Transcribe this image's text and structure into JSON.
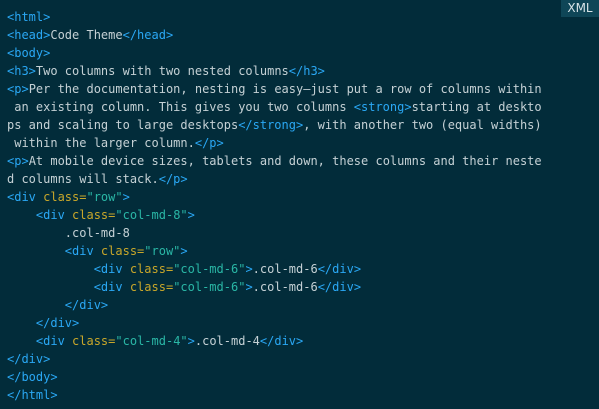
{
  "badge": {
    "language": "XML"
  },
  "colors": {
    "background": "#022c3a",
    "tag": "#2aa8f5",
    "attribute": "#c9a72a",
    "string": "#2ab7a6",
    "text": "#c5d1d5",
    "badge_background": "#0f4657"
  },
  "code": {
    "lines": [
      [
        {
          "t": "tag",
          "v": "<html>"
        }
      ],
      [
        {
          "t": "tag",
          "v": "<head>"
        },
        {
          "t": "txt",
          "v": "Code Theme"
        },
        {
          "t": "tag",
          "v": "</head>"
        }
      ],
      [
        {
          "t": "tag",
          "v": "<body>"
        }
      ],
      [
        {
          "t": "tag",
          "v": "<h3>"
        },
        {
          "t": "txt",
          "v": "Two columns with two nested columns"
        },
        {
          "t": "tag",
          "v": "</h3>"
        }
      ],
      [
        {
          "t": "tag",
          "v": "<p>"
        },
        {
          "t": "txt",
          "v": "Per the documentation, nesting is easy—just put a row of columns within"
        }
      ],
      [
        {
          "t": "txt",
          "v": " an existing column. This gives you two columns "
        },
        {
          "t": "tag",
          "v": "<strong>"
        },
        {
          "t": "txt",
          "v": "starting at deskto"
        }
      ],
      [
        {
          "t": "txt",
          "v": "ps and scaling to large desktops"
        },
        {
          "t": "tag",
          "v": "</strong>"
        },
        {
          "t": "txt",
          "v": ", with another two (equal widths)"
        }
      ],
      [
        {
          "t": "txt",
          "v": " within the larger column."
        },
        {
          "t": "tag",
          "v": "</p>"
        }
      ],
      [
        {
          "t": "tag",
          "v": "<p>"
        },
        {
          "t": "txt",
          "v": "At mobile device sizes, tablets and down, these columns and their neste"
        }
      ],
      [
        {
          "t": "txt",
          "v": "d columns will stack."
        },
        {
          "t": "tag",
          "v": "</p>"
        }
      ],
      [
        {
          "t": "tag",
          "v": "<div "
        },
        {
          "t": "attr",
          "v": "class="
        },
        {
          "t": "str",
          "v": "\"row\""
        },
        {
          "t": "tag",
          "v": ">"
        }
      ],
      [
        {
          "t": "txt",
          "v": "    "
        },
        {
          "t": "tag",
          "v": "<div "
        },
        {
          "t": "attr",
          "v": "class="
        },
        {
          "t": "str",
          "v": "\"col-md-8\""
        },
        {
          "t": "tag",
          "v": ">"
        }
      ],
      [
        {
          "t": "txt",
          "v": "        .col-md-8"
        }
      ],
      [
        {
          "t": "txt",
          "v": "        "
        },
        {
          "t": "tag",
          "v": "<div "
        },
        {
          "t": "attr",
          "v": "class="
        },
        {
          "t": "str",
          "v": "\"row\""
        },
        {
          "t": "tag",
          "v": ">"
        }
      ],
      [
        {
          "t": "txt",
          "v": "            "
        },
        {
          "t": "tag",
          "v": "<div "
        },
        {
          "t": "attr",
          "v": "class="
        },
        {
          "t": "str",
          "v": "\"col-md-6\""
        },
        {
          "t": "tag",
          "v": ">"
        },
        {
          "t": "txt",
          "v": ".col-md-6"
        },
        {
          "t": "tag",
          "v": "</div>"
        }
      ],
      [
        {
          "t": "txt",
          "v": "            "
        },
        {
          "t": "tag",
          "v": "<div "
        },
        {
          "t": "attr",
          "v": "class="
        },
        {
          "t": "str",
          "v": "\"col-md-6\""
        },
        {
          "t": "tag",
          "v": ">"
        },
        {
          "t": "txt",
          "v": ".col-md-6"
        },
        {
          "t": "tag",
          "v": "</div>"
        }
      ],
      [
        {
          "t": "txt",
          "v": "        "
        },
        {
          "t": "tag",
          "v": "</div>"
        }
      ],
      [
        {
          "t": "txt",
          "v": "    "
        },
        {
          "t": "tag",
          "v": "</div>"
        }
      ],
      [
        {
          "t": "txt",
          "v": "    "
        },
        {
          "t": "tag",
          "v": "<div "
        },
        {
          "t": "attr",
          "v": "class="
        },
        {
          "t": "str",
          "v": "\"col-md-4\""
        },
        {
          "t": "tag",
          "v": ">"
        },
        {
          "t": "txt",
          "v": ".col-md-4"
        },
        {
          "t": "tag",
          "v": "</div>"
        }
      ],
      [
        {
          "t": "tag",
          "v": "</div>"
        }
      ],
      [
        {
          "t": "tag",
          "v": "</body>"
        }
      ],
      [
        {
          "t": "tag",
          "v": "</html>"
        }
      ]
    ]
  }
}
